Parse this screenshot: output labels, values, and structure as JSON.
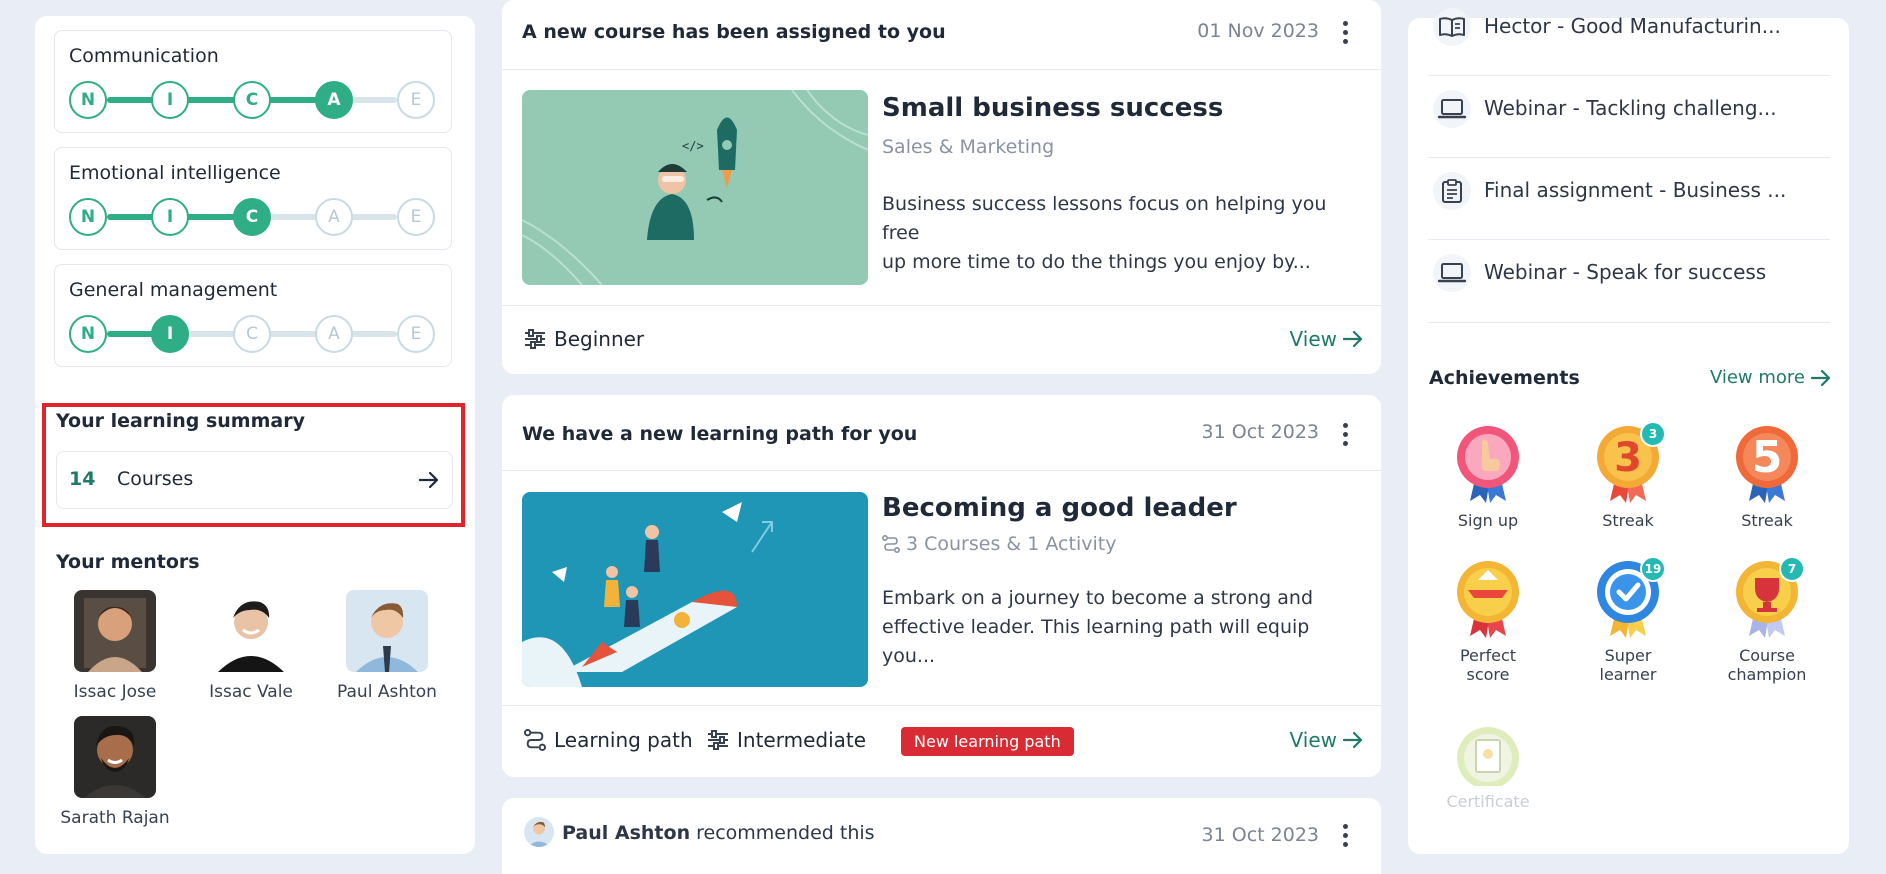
{
  "skills": [
    {
      "name": "Communication",
      "levels": [
        "N",
        "I",
        "C",
        "A",
        "E"
      ],
      "current": 4
    },
    {
      "name": "Emotional intelligence",
      "levels": [
        "N",
        "I",
        "C",
        "A",
        "E"
      ],
      "current": 3
    },
    {
      "name": "General management",
      "levels": [
        "N",
        "I",
        "C",
        "A",
        "E"
      ],
      "current": 2
    }
  ],
  "summary": {
    "title": "Your learning summary",
    "count": "14",
    "label": "Courses"
  },
  "mentors": {
    "title": "Your mentors",
    "people": [
      {
        "name": "Issac Jose"
      },
      {
        "name": "Issac Vale"
      },
      {
        "name": "Paul Ashton"
      },
      {
        "name": "Sarath Rajan"
      }
    ]
  },
  "feed": [
    {
      "header": "A new course has been assigned to you",
      "date": "01 Nov 2023",
      "title": "Small business success",
      "subtitle": "Sales & Marketing",
      "description_line1": "Business success lessons focus on helping you free",
      "description_line2": "up more time to do the things you enjoy by...",
      "level": "Beginner",
      "view": "View"
    },
    {
      "header": "We have a new learning path for you",
      "date": "31 Oct 2023",
      "title": "Becoming a good leader",
      "subtitle": "3 Courses & 1 Activity",
      "description_line1": "Embark on a journey to become a strong and",
      "description_line2": "effective leader. This learning path will equip you...",
      "type": "Learning path",
      "level": "Intermediate",
      "badge": "New learning path",
      "view": "View"
    },
    {
      "author": "Paul Ashton",
      "action": "recommended this",
      "date": "31 Oct 2023"
    }
  ],
  "upcoming": [
    {
      "icon": "book-open-icon",
      "text": "Hector - Good Manufacturin..."
    },
    {
      "icon": "laptop-icon",
      "text": "Webinar - Tackling challeng..."
    },
    {
      "icon": "clipboard-icon",
      "text": "Final assignment - Business ..."
    },
    {
      "icon": "laptop-icon",
      "text": "Webinar - Speak for success"
    }
  ],
  "achievements": {
    "title": "Achievements",
    "view_more": "View more",
    "items": [
      {
        "label_line1": "Sign up",
        "label_line2": "",
        "count": ""
      },
      {
        "label_line1": "Streak",
        "label_line2": "",
        "count": "3",
        "number": "3"
      },
      {
        "label_line1": "Streak",
        "label_line2": "",
        "count": "",
        "number": "5"
      },
      {
        "label_line1": "Perfect",
        "label_line2": "score",
        "count": ""
      },
      {
        "label_line1": "Super",
        "label_line2": "learner",
        "count": "19"
      },
      {
        "label_line1": "Course",
        "label_line2": "champion",
        "count": "7"
      },
      {
        "label_line1": "Certificate",
        "label_line2": "",
        "count": ""
      }
    ]
  },
  "colors": {
    "accent": "#2fae85",
    "link": "#1f7a6a",
    "badge": "#d92b33",
    "highlight_box": "#e0242c"
  }
}
